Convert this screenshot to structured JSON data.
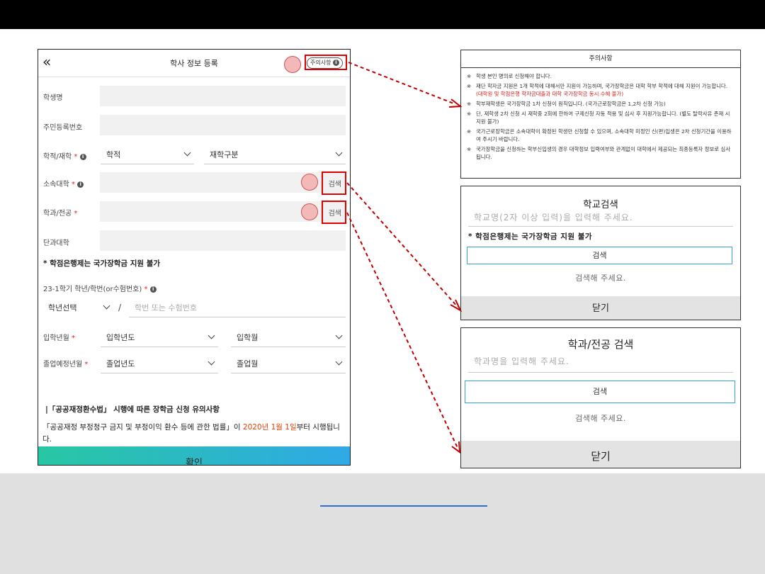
{
  "form": {
    "title": "학사 정보 등록",
    "back_icon": "«",
    "notice_chip": "주의사항",
    "info_glyph": "i",
    "student_name_label": "학생명",
    "resident_no_label": "주민등록번호",
    "status_label": "학적/재학",
    "req_mark": "*",
    "status_select": "학적",
    "enroll_select": "재학구분",
    "university_label": "소속대학",
    "search_label": "검색",
    "major_label": "학과/전공",
    "college_label": "단과대학",
    "credit_bank_warning": "* 학점은행제는 국가장학금 지원 불가",
    "grade_label": "23-1학기 학년/학번(or수험번호)",
    "grade_select": "학년선택",
    "slash": "/",
    "student_no_placeholder": "학번 또는 수험번호",
    "admission_label": "입학년월",
    "admission_year": "입학년도",
    "admission_month": "입학월",
    "graduation_label": "졸업예정년월",
    "graduation_year": "졸업년도",
    "graduation_month": "졸업월",
    "section_title": "|「공공재정환수법」 시행에 따른 장학금 신청 유의사항",
    "para_a": "「공공재정 부정청구 금지 및 부정이익 환수 등에 관한 법률」이 ",
    "para_date": "2020년 1월 1일",
    "para_b": "부터 시행됩니다.",
    "confirm_label": "확인"
  },
  "notice_panel": {
    "title": "주의사항",
    "items": [
      {
        "text": "학생 본인 명의로 신청해야 합니다.",
        "red": ""
      },
      {
        "text": "재단 학자금 지원은 1개 학적에 대해서만 지원이 가능하며, 국가장학금은 대학 학부 학적에 대해 지원이 가능합니다. ",
        "red": "(대학원 및 학점은행 학자금대출과 대학 국가장학금 동시 수혜 불가)"
      },
      {
        "text": "학부재학생은 국가장학금 1차 신청이 원칙입니다. (국가근로장학금은 1,2차 신청 가능)",
        "red": ""
      },
      {
        "text": "단, 재학생 2차 신청 시 재학중 2회에 한하여 구제신청 자동 적용 및 심사 후 지원가능합니다. (별도 탈락사유 존재 시 지원 불가)",
        "red": ""
      },
      {
        "text": "국가근로장학금은 소속대학이 확정된 학생만 신청할 수 있으며, 소속대학 미정인 신(편)입생은 2차 신청기간을 이용하여 주시기 바랍니다.",
        "red": ""
      },
      {
        "text": "국가장학금을 신청하는 학부신입생의 경우 대학정보 입력여부와 관계없이 대학에서 제공되는 최종등록자 정보로 심사됩니다.",
        "red": ""
      }
    ]
  },
  "school_search": {
    "title": "학교검색",
    "placeholder": "학교명(2자 이상 입력)을 입력해 주세요.",
    "note": "* 학점은행제는 국가장학금 지원 불가",
    "button": "검색",
    "message": "검색해 주세요.",
    "close": "닫기"
  },
  "major_search": {
    "title": "학과/전공 검색",
    "placeholder": "학과명을 입력해 주세요.",
    "button": "검색",
    "message": "검색해 주세요.",
    "close": "닫기"
  },
  "colors": {
    "highlight_red": "#e00000",
    "gradient_start": "#28c7a3",
    "gradient_end": "#2fa9e6",
    "marker_fill": "#f3b8b8",
    "link_blue": "#2e6fd6"
  },
  "icons": [
    "chevron-double-left-icon",
    "info-icon",
    "chevron-down-icon",
    "arrow-icon"
  ]
}
